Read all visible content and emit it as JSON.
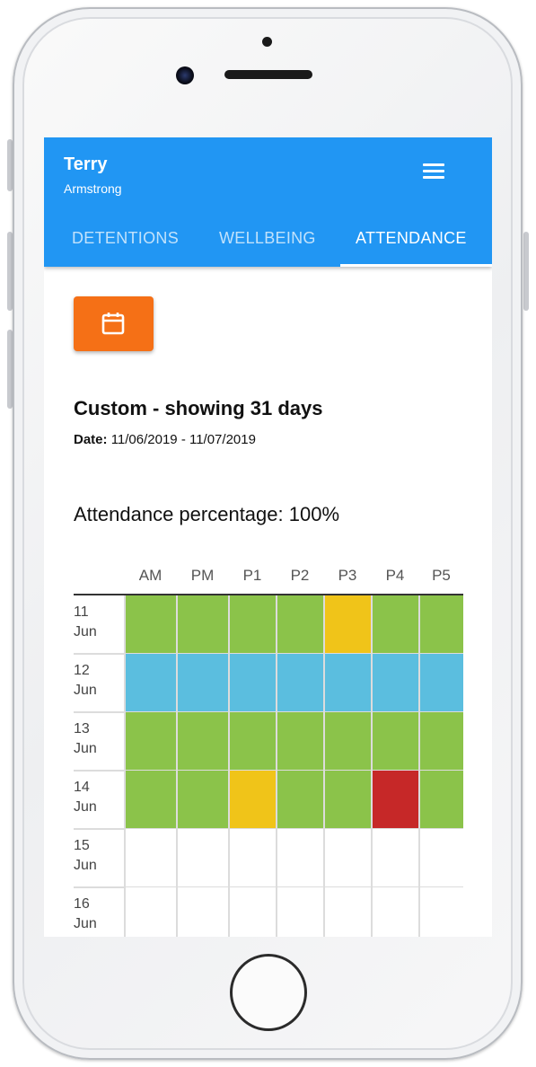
{
  "header": {
    "first_name": "Terry",
    "last_name": "Armstrong",
    "menu_icon": "hamburger-menu-icon"
  },
  "tabs": [
    {
      "label": "DETENTIONS",
      "active": false
    },
    {
      "label": "WELLBEING",
      "active": false
    },
    {
      "label": "ATTENDANCE",
      "active": true
    }
  ],
  "calendar_button": {
    "icon": "calendar-icon",
    "color": "#f57016"
  },
  "range": {
    "title": "Custom - showing 31 days",
    "date_label": "Date:",
    "date_value": "11/06/2019 - 11/07/2019"
  },
  "attendance": {
    "label": "Attendance percentage: 100%"
  },
  "grid": {
    "columns": [
      "AM",
      "PM",
      "P1",
      "P2",
      "P3",
      "P4",
      "P5"
    ],
    "status_colors": {
      "present": "#8bc34a",
      "late": "#f0c419",
      "absent": "#c62828",
      "holiday": "#5bbedf",
      "none": "#ffffff"
    },
    "rows": [
      {
        "day": "11",
        "month": "Jun",
        "cells": [
          "present",
          "present",
          "present",
          "present",
          "late",
          "present",
          "present"
        ]
      },
      {
        "day": "12",
        "month": "Jun",
        "cells": [
          "holiday",
          "holiday",
          "holiday",
          "holiday",
          "holiday",
          "holiday",
          "holiday"
        ]
      },
      {
        "day": "13",
        "month": "Jun",
        "cells": [
          "present",
          "present",
          "present",
          "present",
          "present",
          "present",
          "present"
        ]
      },
      {
        "day": "14",
        "month": "Jun",
        "cells": [
          "present",
          "present",
          "late",
          "present",
          "present",
          "absent",
          "present"
        ]
      },
      {
        "day": "15",
        "month": "Jun",
        "cells": [
          "none",
          "none",
          "none",
          "none",
          "none",
          "none",
          "none"
        ]
      },
      {
        "day": "16",
        "month": "Jun",
        "cells": [
          "none",
          "none",
          "none",
          "none",
          "none",
          "none",
          "none"
        ]
      }
    ]
  }
}
